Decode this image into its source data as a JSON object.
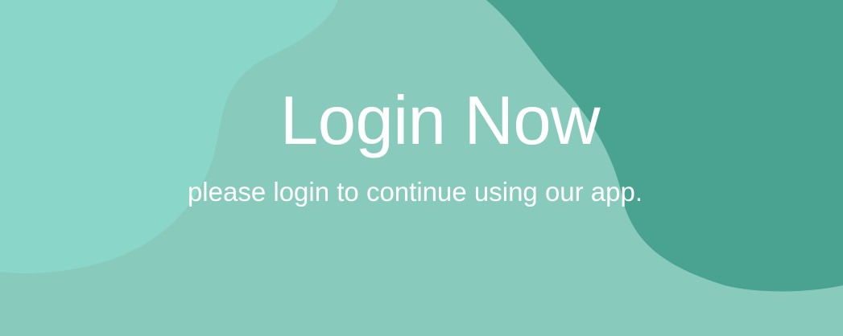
{
  "hero": {
    "title": "Login Now",
    "subtitle": "please login to continue using our app."
  },
  "colors": {
    "background": "#88cbbd",
    "blob_light": "#8ad7c9",
    "blob_dark": "#4aa291",
    "text": "#ffffff"
  }
}
